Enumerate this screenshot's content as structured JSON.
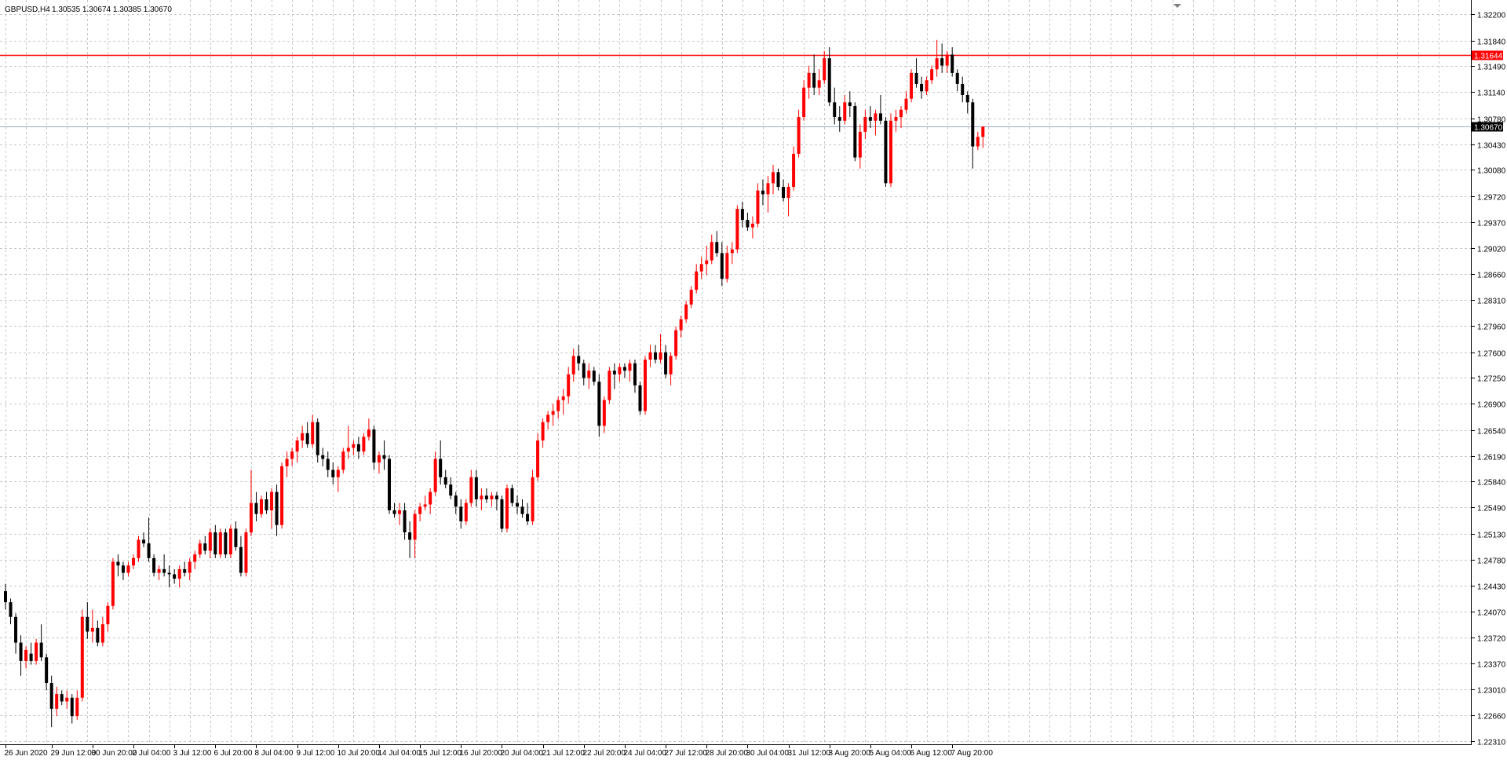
{
  "header": {
    "symbol": "GBPUSD,H4",
    "ohlc": "1.30535 1.30674 1.30385 1.30670"
  },
  "chart_data": {
    "type": "candlestick",
    "symbol": "GBPUSD",
    "timeframe": "H4",
    "ylim": [
      1.2231,
      1.322
    ],
    "grid": true,
    "colors": {
      "background": "#ffffff",
      "grid": "#c8c8c8",
      "bull": "#ff0000",
      "bear": "#000000",
      "doji": "#00c000",
      "hline": "#ff0000",
      "last_price_line": "#a0a8c0",
      "last_price_tag": "#000000"
    },
    "hline": {
      "value": 1.31644,
      "label": "1.31644"
    },
    "last_price": {
      "value": 1.3067,
      "label": "1.30670"
    },
    "y_ticks": [
      "1.32200",
      "1.31840",
      "1.31490",
      "1.31140",
      "1.30780",
      "1.30430",
      "1.30080",
      "1.29720",
      "1.29370",
      "1.29020",
      "1.28660",
      "1.28310",
      "1.27960",
      "1.27600",
      "1.27250",
      "1.26900",
      "1.26540",
      "1.26190",
      "1.25840",
      "1.25490",
      "1.25130",
      "1.24780",
      "1.24430",
      "1.24070",
      "1.23720",
      "1.23370",
      "1.23010",
      "1.22660",
      "1.22310"
    ],
    "x_ticks": [
      {
        "label": "26 Jun 2020",
        "bar": 0
      },
      {
        "label": "29 Jun 12:00",
        "bar": 9
      },
      {
        "label": "30 Jun 20:00",
        "bar": 17
      },
      {
        "label": "2 Jul 04:00",
        "bar": 25
      },
      {
        "label": "3 Jul 12:00",
        "bar": 33
      },
      {
        "label": "6 Jul 20:00",
        "bar": 41
      },
      {
        "label": "8 Jul 04:00",
        "bar": 49
      },
      {
        "label": "9 Jul 12:00",
        "bar": 57
      },
      {
        "label": "10 Jul 20:00",
        "bar": 65
      },
      {
        "label": "14 Jul 04:00",
        "bar": 73
      },
      {
        "label": "15 Jul 12:00",
        "bar": 81
      },
      {
        "label": "16 Jul 20:00",
        "bar": 89
      },
      {
        "label": "20 Jul 04:00",
        "bar": 97
      },
      {
        "label": "21 Jul 12:00",
        "bar": 105
      },
      {
        "label": "22 Jul 20:00",
        "bar": 113
      },
      {
        "label": "24 Jul 04:00",
        "bar": 121
      },
      {
        "label": "27 Jul 12:00",
        "bar": 129
      },
      {
        "label": "28 Jul 20:00",
        "bar": 137
      },
      {
        "label": "30 Jul 04:00",
        "bar": 145
      },
      {
        "label": "31 Jul 12:00",
        "bar": 153
      },
      {
        "label": "3 Aug 20:00",
        "bar": 161
      },
      {
        "label": "5 Aug 04:00",
        "bar": 169
      },
      {
        "label": "6 Aug 12:00",
        "bar": 177
      },
      {
        "label": "7 Aug 20:00",
        "bar": 185
      }
    ],
    "candles": [
      [
        1.2435,
        1.2445,
        1.241,
        1.242
      ],
      [
        1.242,
        1.2425,
        1.239,
        1.24
      ],
      [
        1.24,
        1.2405,
        1.235,
        1.2365
      ],
      [
        1.2365,
        1.2375,
        1.232,
        1.234
      ],
      [
        1.234,
        1.236,
        1.233,
        1.2355
      ],
      [
        1.235,
        1.2365,
        1.2335,
        1.234
      ],
      [
        1.234,
        1.237,
        1.2335,
        1.2365
      ],
      [
        1.2365,
        1.239,
        1.234,
        1.2345
      ],
      [
        1.2345,
        1.235,
        1.23,
        1.231
      ],
      [
        1.231,
        1.232,
        1.225,
        1.2275
      ],
      [
        1.2275,
        1.2305,
        1.2265,
        1.2295
      ],
      [
        1.2295,
        1.23,
        1.228,
        1.2285
      ],
      [
        1.2285,
        1.23,
        1.2275,
        1.229
      ],
      [
        1.229,
        1.2295,
        1.2255,
        1.2265
      ],
      [
        1.2265,
        1.23,
        1.226,
        1.229
      ],
      [
        1.229,
        1.241,
        1.2285,
        1.24
      ],
      [
        1.24,
        1.242,
        1.237,
        1.238
      ],
      [
        1.238,
        1.241,
        1.2365,
        1.2385
      ],
      [
        1.2385,
        1.2395,
        1.236,
        1.2365
      ],
      [
        1.2365,
        1.24,
        1.236,
        1.239
      ],
      [
        1.239,
        1.242,
        1.238,
        1.2415
      ],
      [
        1.2415,
        1.248,
        1.241,
        1.2475
      ],
      [
        1.2475,
        1.2485,
        1.2455,
        1.247
      ],
      [
        1.247,
        1.2475,
        1.245,
        1.246
      ],
      [
        1.246,
        1.2475,
        1.2455,
        1.247
      ],
      [
        1.247,
        1.2485,
        1.2465,
        1.248
      ],
      [
        1.248,
        1.251,
        1.2475,
        1.2505
      ],
      [
        1.2505,
        1.2515,
        1.2495,
        1.25
      ],
      [
        1.25,
        1.2535,
        1.2475,
        1.248
      ],
      [
        1.248,
        1.2485,
        1.2455,
        1.246
      ],
      [
        1.246,
        1.247,
        1.245,
        1.2465
      ],
      [
        1.2465,
        1.2485,
        1.2455,
        1.246
      ],
      [
        1.246,
        1.247,
        1.244,
        1.2458
      ],
      [
        1.2458,
        1.2465,
        1.2445,
        1.2452
      ],
      [
        1.2452,
        1.247,
        1.244,
        1.2465
      ],
      [
        1.2465,
        1.2475,
        1.2455,
        1.246
      ],
      [
        1.246,
        1.248,
        1.245,
        1.2475
      ],
      [
        1.2475,
        1.249,
        1.2465,
        1.2485
      ],
      [
        1.2485,
        1.2505,
        1.248,
        1.25
      ],
      [
        1.25,
        1.251,
        1.2485,
        1.249
      ],
      [
        1.249,
        1.252,
        1.248,
        1.2515
      ],
      [
        1.2515,
        1.2525,
        1.248,
        1.2485
      ],
      [
        1.2485,
        1.252,
        1.248,
        1.2515
      ],
      [
        1.2515,
        1.252,
        1.248,
        1.2485
      ],
      [
        1.2485,
        1.2525,
        1.248,
        1.252
      ],
      [
        1.252,
        1.253,
        1.249,
        1.2495
      ],
      [
        1.2495,
        1.251,
        1.2455,
        1.246
      ],
      [
        1.246,
        1.252,
        1.2455,
        1.2515
      ],
      [
        1.2515,
        1.26,
        1.251,
        1.2555
      ],
      [
        1.2555,
        1.257,
        1.253,
        1.254
      ],
      [
        1.254,
        1.2565,
        1.2535,
        1.256
      ],
      [
        1.256,
        1.257,
        1.254,
        1.2545
      ],
      [
        1.2545,
        1.2575,
        1.252,
        1.257
      ],
      [
        1.257,
        1.258,
        1.251,
        1.2525
      ],
      [
        1.2525,
        1.261,
        1.252,
        1.2605
      ],
      [
        1.2605,
        1.2625,
        1.259,
        1.2615
      ],
      [
        1.2615,
        1.263,
        1.2605,
        1.2625
      ],
      [
        1.2625,
        1.2645,
        1.261,
        1.264
      ],
      [
        1.264,
        1.266,
        1.263,
        1.265
      ],
      [
        1.265,
        1.2665,
        1.263,
        1.2635
      ],
      [
        1.2635,
        1.2675,
        1.263,
        1.2665
      ],
      [
        1.2665,
        1.267,
        1.261,
        1.262
      ],
      [
        1.262,
        1.263,
        1.2605,
        1.2615
      ],
      [
        1.2615,
        1.2625,
        1.259,
        1.26
      ],
      [
        1.26,
        1.261,
        1.258,
        1.259
      ],
      [
        1.259,
        1.2605,
        1.257,
        1.26
      ],
      [
        1.26,
        1.263,
        1.2595,
        1.2625
      ],
      [
        1.2625,
        1.266,
        1.2615,
        1.263
      ],
      [
        1.263,
        1.264,
        1.262,
        1.2635
      ],
      [
        1.2635,
        1.2645,
        1.2615,
        1.2625
      ],
      [
        1.2625,
        1.265,
        1.262,
        1.2645
      ],
      [
        1.2645,
        1.267,
        1.264,
        1.2655
      ],
      [
        1.2655,
        1.266,
        1.26,
        1.261
      ],
      [
        1.261,
        1.2625,
        1.2595,
        1.262
      ],
      [
        1.262,
        1.264,
        1.26,
        1.2615
      ],
      [
        1.2615,
        1.262,
        1.254,
        1.2545
      ],
      [
        1.2545,
        1.2555,
        1.2535,
        1.254
      ],
      [
        1.254,
        1.2555,
        1.2525,
        1.2545
      ],
      [
        1.2545,
        1.2555,
        1.2505,
        1.2515
      ],
      [
        1.2515,
        1.253,
        1.248,
        1.2505
      ],
      [
        1.2505,
        1.2545,
        1.248,
        1.254
      ],
      [
        1.254,
        1.2555,
        1.253,
        1.255
      ],
      [
        1.255,
        1.2565,
        1.2545,
        1.2553
      ],
      [
        1.2553,
        1.2575,
        1.254,
        1.257
      ],
      [
        1.257,
        1.2625,
        1.2565,
        1.2615
      ],
      [
        1.2615,
        1.264,
        1.258,
        1.259
      ],
      [
        1.259,
        1.26,
        1.2575,
        1.258
      ],
      [
        1.258,
        1.259,
        1.256,
        1.2565
      ],
      [
        1.2565,
        1.257,
        1.254,
        1.255
      ],
      [
        1.255,
        1.256,
        1.252,
        1.253
      ],
      [
        1.253,
        1.256,
        1.2525,
        1.2555
      ],
      [
        1.2555,
        1.26,
        1.255,
        1.259
      ],
      [
        1.259,
        1.26,
        1.255,
        1.256
      ],
      [
        1.256,
        1.2575,
        1.2545,
        1.2565
      ],
      [
        1.2565,
        1.2575,
        1.2555,
        1.256
      ],
      [
        1.256,
        1.257,
        1.255,
        1.2565
      ],
      [
        1.2565,
        1.257,
        1.2545,
        1.256
      ],
      [
        1.256,
        1.2565,
        1.2515,
        1.252
      ],
      [
        1.252,
        1.258,
        1.2515,
        1.2575
      ],
      [
        1.2575,
        1.258,
        1.255,
        1.2555
      ],
      [
        1.2555,
        1.2565,
        1.254,
        1.255
      ],
      [
        1.255,
        1.256,
        1.2535,
        1.254
      ],
      [
        1.254,
        1.2555,
        1.2525,
        1.253
      ],
      [
        1.253,
        1.26,
        1.2525,
        1.259
      ],
      [
        1.259,
        1.265,
        1.2585,
        1.264
      ],
      [
        1.264,
        1.267,
        1.263,
        1.2665
      ],
      [
        1.2665,
        1.268,
        1.2655,
        1.2675
      ],
      [
        1.2675,
        1.269,
        1.266,
        1.268
      ],
      [
        1.268,
        1.27,
        1.267,
        1.2695
      ],
      [
        1.2695,
        1.271,
        1.2675,
        1.27
      ],
      [
        1.27,
        1.274,
        1.269,
        1.273
      ],
      [
        1.273,
        1.2765,
        1.272,
        1.2755
      ],
      [
        1.2755,
        1.277,
        1.2735,
        1.2745
      ],
      [
        1.2745,
        1.275,
        1.2715,
        1.2725
      ],
      [
        1.2725,
        1.2745,
        1.271,
        1.2735
      ],
      [
        1.2735,
        1.274,
        1.2715,
        1.272
      ],
      [
        1.272,
        1.273,
        1.2645,
        1.266
      ],
      [
        1.266,
        1.27,
        1.265,
        1.2695
      ],
      [
        1.2695,
        1.274,
        1.269,
        1.2735
      ],
      [
        1.2735,
        1.2745,
        1.271,
        1.273
      ],
      [
        1.273,
        1.2745,
        1.272,
        1.274
      ],
      [
        1.274,
        1.2745,
        1.2725,
        1.2735
      ],
      [
        1.2735,
        1.275,
        1.272,
        1.2745
      ],
      [
        1.2745,
        1.275,
        1.2705,
        1.2715
      ],
      [
        1.2715,
        1.272,
        1.2675,
        1.268
      ],
      [
        1.268,
        1.2755,
        1.2675,
        1.275
      ],
      [
        1.275,
        1.277,
        1.274,
        1.276
      ],
      [
        1.276,
        1.277,
        1.2745,
        1.275
      ],
      [
        1.275,
        1.2785,
        1.2745,
        1.276
      ],
      [
        1.276,
        1.277,
        1.2725,
        1.273
      ],
      [
        1.273,
        1.276,
        1.2715,
        1.2755
      ],
      [
        1.2755,
        1.2795,
        1.275,
        1.279
      ],
      [
        1.279,
        1.281,
        1.278,
        1.2805
      ],
      [
        1.2805,
        1.283,
        1.28,
        1.2825
      ],
      [
        1.2825,
        1.285,
        1.282,
        1.2845
      ],
      [
        1.2845,
        1.288,
        1.284,
        1.287
      ],
      [
        1.287,
        1.289,
        1.286,
        1.288
      ],
      [
        1.288,
        1.2905,
        1.2865,
        1.2885
      ],
      [
        1.2885,
        1.292,
        1.288,
        1.291
      ],
      [
        1.291,
        1.2925,
        1.289,
        1.2895
      ],
      [
        1.2895,
        1.291,
        1.285,
        1.286
      ],
      [
        1.286,
        1.2905,
        1.2855,
        1.2895
      ],
      [
        1.2895,
        1.291,
        1.288,
        1.29
      ],
      [
        1.29,
        1.296,
        1.2895,
        1.2955
      ],
      [
        1.2955,
        1.2965,
        1.293,
        1.294
      ],
      [
        1.294,
        1.295,
        1.2925,
        1.293
      ],
      [
        1.293,
        1.2945,
        1.2915,
        1.2935
      ],
      [
        1.2935,
        1.299,
        1.293,
        1.298
      ],
      [
        1.298,
        1.2995,
        1.296,
        1.2975
      ],
      [
        1.2975,
        1.3,
        1.295,
        1.299
      ],
      [
        1.299,
        1.3015,
        1.2975,
        1.3005
      ],
      [
        1.3005,
        1.301,
        1.298,
        1.2985
      ],
      [
        1.2985,
        1.2995,
        1.2965,
        1.297
      ],
      [
        1.297,
        1.299,
        1.2945,
        1.2985
      ],
      [
        1.2985,
        1.304,
        1.298,
        1.303
      ],
      [
        1.303,
        1.309,
        1.3025,
        1.308
      ],
      [
        1.308,
        1.313,
        1.3075,
        1.312
      ],
      [
        1.312,
        1.315,
        1.3105,
        1.314
      ],
      [
        1.314,
        1.3165,
        1.311,
        1.312
      ],
      [
        1.312,
        1.3145,
        1.311,
        1.313
      ],
      [
        1.313,
        1.317,
        1.3125,
        1.316
      ],
      [
        1.316,
        1.3175,
        1.3095,
        1.31
      ],
      [
        1.31,
        1.312,
        1.307,
        1.308
      ],
      [
        1.308,
        1.3095,
        1.306,
        1.3075
      ],
      [
        1.3075,
        1.311,
        1.307,
        1.31
      ],
      [
        1.31,
        1.3115,
        1.308,
        1.3095
      ],
      [
        1.3095,
        1.31,
        1.302,
        1.3025
      ],
      [
        1.3025,
        1.307,
        1.301,
        1.306
      ],
      [
        1.306,
        1.309,
        1.305,
        1.308
      ],
      [
        1.308,
        1.3095,
        1.3065,
        1.3075
      ],
      [
        1.3075,
        1.309,
        1.3055,
        1.3085
      ],
      [
        1.3085,
        1.311,
        1.307,
        1.3075
      ],
      [
        1.3075,
        1.308,
        1.2985,
        1.299
      ],
      [
        1.299,
        1.3085,
        1.2985,
        1.3075
      ],
      [
        1.3075,
        1.309,
        1.306,
        1.308
      ],
      [
        1.308,
        1.3095,
        1.3065,
        1.309
      ],
      [
        1.309,
        1.3115,
        1.3085,
        1.3105
      ],
      [
        1.3105,
        1.3145,
        1.31,
        1.314
      ],
      [
        1.314,
        1.316,
        1.312,
        1.3125
      ],
      [
        1.3125,
        1.3135,
        1.3105,
        1.3115
      ],
      [
        1.3115,
        1.3135,
        1.311,
        1.313
      ],
      [
        1.313,
        1.315,
        1.3125,
        1.3145
      ],
      [
        1.3145,
        1.3185,
        1.3135,
        1.316
      ],
      [
        1.316,
        1.318,
        1.314,
        1.315
      ],
      [
        1.315,
        1.317,
        1.314,
        1.3165
      ],
      [
        1.3165,
        1.3175,
        1.3135,
        1.314
      ],
      [
        1.314,
        1.3145,
        1.3115,
        1.3125
      ],
      [
        1.3125,
        1.3135,
        1.31,
        1.311
      ],
      [
        1.311,
        1.3115,
        1.3085,
        1.31
      ],
      [
        1.31,
        1.3105,
        1.301,
        1.304
      ],
      [
        1.304,
        1.306,
        1.3035,
        1.3053
      ],
      [
        1.3053,
        1.3067,
        1.3038,
        1.3067
      ]
    ]
  }
}
